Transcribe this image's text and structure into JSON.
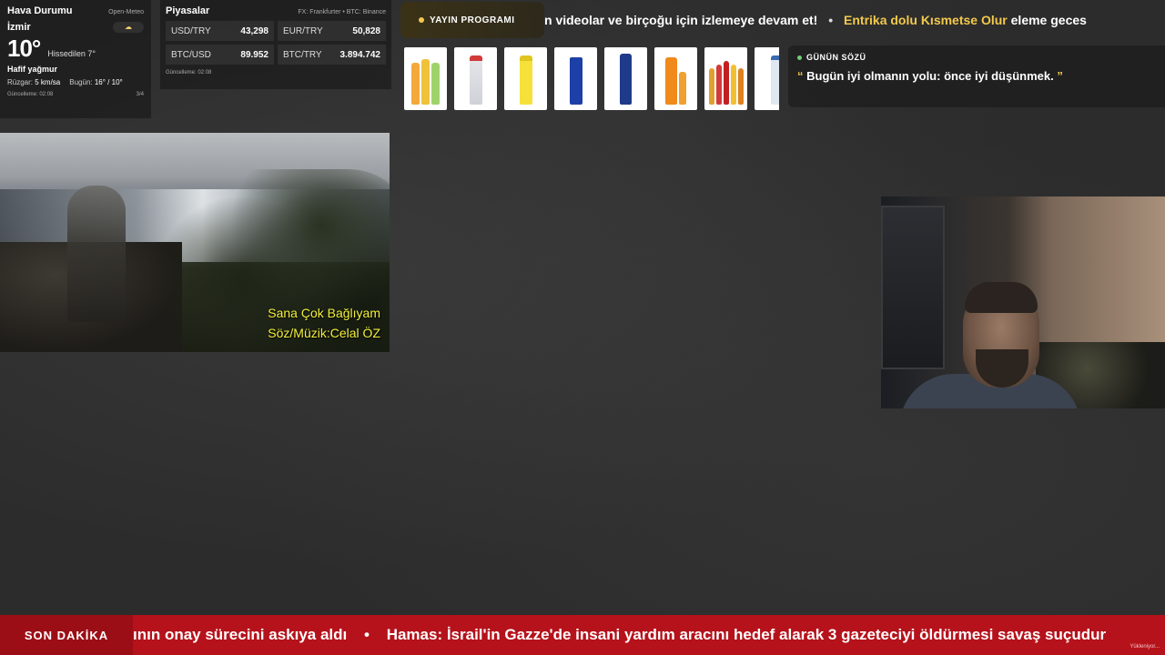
{
  "weather": {
    "title": "Hava Durumu",
    "source": "Open-Meteo",
    "city": "İzmir",
    "icon": "partly-cloudy-icon",
    "temperature": "10°",
    "feels_like": "Hissedilen 7°",
    "condition": "Hafif yağmur",
    "wind_label": "Rüzgar:",
    "wind_value": "5 km/sa",
    "today_label": "Bugün:",
    "today_value": "16° / 10°",
    "updated": "Güncelleme: 02:08",
    "page": "3/4"
  },
  "markets": {
    "title": "Piyasalar",
    "source": "FX: Frankfurter • BTC: Binance",
    "items": [
      {
        "symbol": "USD/TRY",
        "value": "43,298"
      },
      {
        "symbol": "EUR/TRY",
        "value": "50,828"
      },
      {
        "symbol": "BTC/USD",
        "value": "89.952"
      },
      {
        "symbol": "BTC/TRY",
        "value": "3.894.742"
      }
    ],
    "updated": "Güncelleme: 02:08"
  },
  "schedule": {
    "badge": "YAYIN PROGRAMI",
    "ticker_part1": "n videolar ve birçoğu için izlemeye devam et!",
    "ticker_sep": "•",
    "ticker_highlight": "Entrika dolu Kısmetse Olur",
    "ticker_part2": "eleme geces"
  },
  "quote": {
    "label": "GÜNÜN SÖZÜ",
    "open_mark": "“",
    "text": "Bugün iyi olmanın yolu: önce iyi düşünmek.",
    "close_mark": "”"
  },
  "video": {
    "caption_line1": "Sana Çok Bağlıyam",
    "caption_line2": "Söz/Müzik:Celal ÖZ"
  },
  "breaking": {
    "label": "SON DAKİKA",
    "text_part1": "ının onay sürecini askıya aldı",
    "sep": "•",
    "text_part2": "Hamas: İsrail'in Gazze'de insani yardım aracını hedef alarak 3 gazeteciyi öldürmesi savaş suçudur",
    "status": "Yükleniyor..."
  },
  "colors": {
    "accent": "#f2c94c",
    "breaking_bg": "#b5121b",
    "caption": "#f2ef3a"
  }
}
